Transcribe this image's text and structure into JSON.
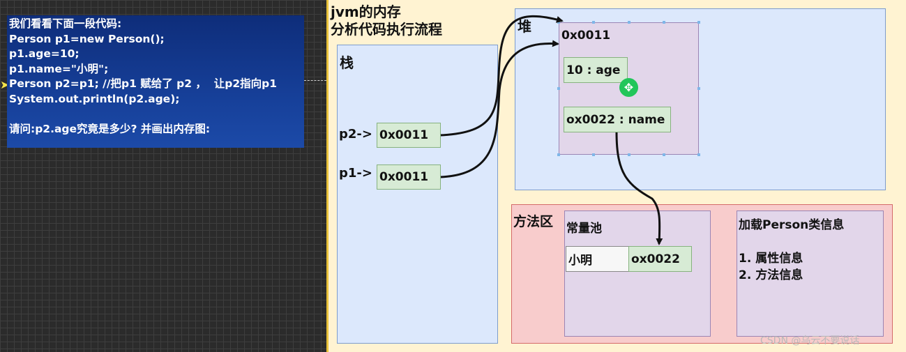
{
  "code_panel": {
    "lines": [
      "我们看看下面一段代码:",
      "Person p1=new Person();",
      "p1.age=10;",
      "p1.name=\"小明\";",
      "Person p2=p1; //把p1 赋给了 p2 ，  让p2指向p1",
      "System.out.println(p2.age);",
      "",
      "请问:p2.age究竟是多少? 并画出内存图:"
    ]
  },
  "diagram": {
    "title_line1": "jvm的内存",
    "title_line2": "分析代码执行流程",
    "stack": {
      "label": "栈",
      "p2_label": "p2->",
      "p2_value": "0x0011",
      "p1_label": "p1->",
      "p1_value": "0x0011"
    },
    "heap": {
      "label": "堆",
      "object_address": "0x0011",
      "age_field": "10 : age",
      "name_field": "ox0022 : name"
    },
    "method_area": {
      "label": "方法区",
      "constant_pool": {
        "label": "常量池",
        "string_value": "小明",
        "string_address": "ox0022"
      },
      "class_info": {
        "title": "加载Person类信息",
        "item1": "1. 属性信息",
        "item2": "2. 方法信息"
      }
    }
  },
  "watermark": "CSDN @乌云不要说话",
  "colors": {
    "code_bg": "#163f98",
    "region_blue": "#dce8fc",
    "region_pink": "#f8cccc",
    "purple_box": "#e2d6ea",
    "green_cell": "#d7ebd5",
    "canvas_bg": "#fff3d2"
  },
  "icons": {
    "cursor": "move-cursor-icon",
    "pointer": "arrow-pointer-icon"
  }
}
